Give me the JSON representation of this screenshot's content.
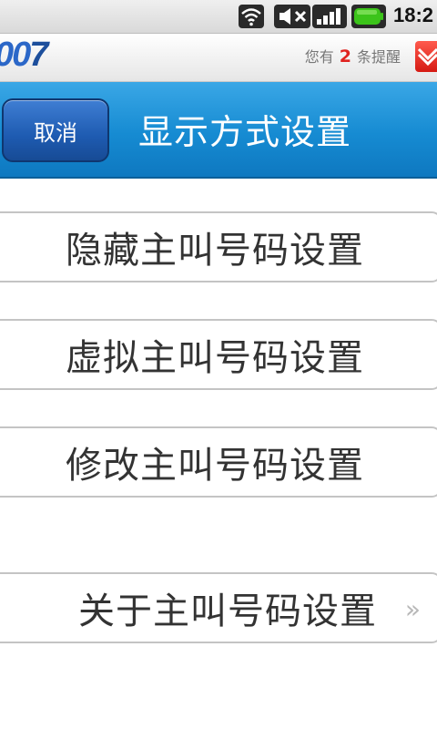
{
  "status_bar": {
    "time": "18:2",
    "icons": [
      "wifi-icon",
      "mute-icon",
      "signal-icon",
      "battery-icon"
    ]
  },
  "app_bar": {
    "logo_prefix": "00",
    "logo_suffix": "7",
    "reminder_prefix": "您有",
    "reminder_count": "2",
    "reminder_suffix": "条提醒"
  },
  "header": {
    "cancel_label": "取消",
    "title": "显示方式设置"
  },
  "menu": {
    "items": [
      {
        "label": "隐藏主叫号码设置"
      },
      {
        "label": "虚拟主叫号码设置"
      },
      {
        "label": "修改主叫号码设置"
      },
      {
        "label": "关于主叫号码设置"
      }
    ]
  },
  "colors": {
    "header_blue": "#168bd2",
    "button_blue": "#1e5bb1",
    "badge_red": "#e0231f",
    "battery_green": "#3cc41a"
  }
}
